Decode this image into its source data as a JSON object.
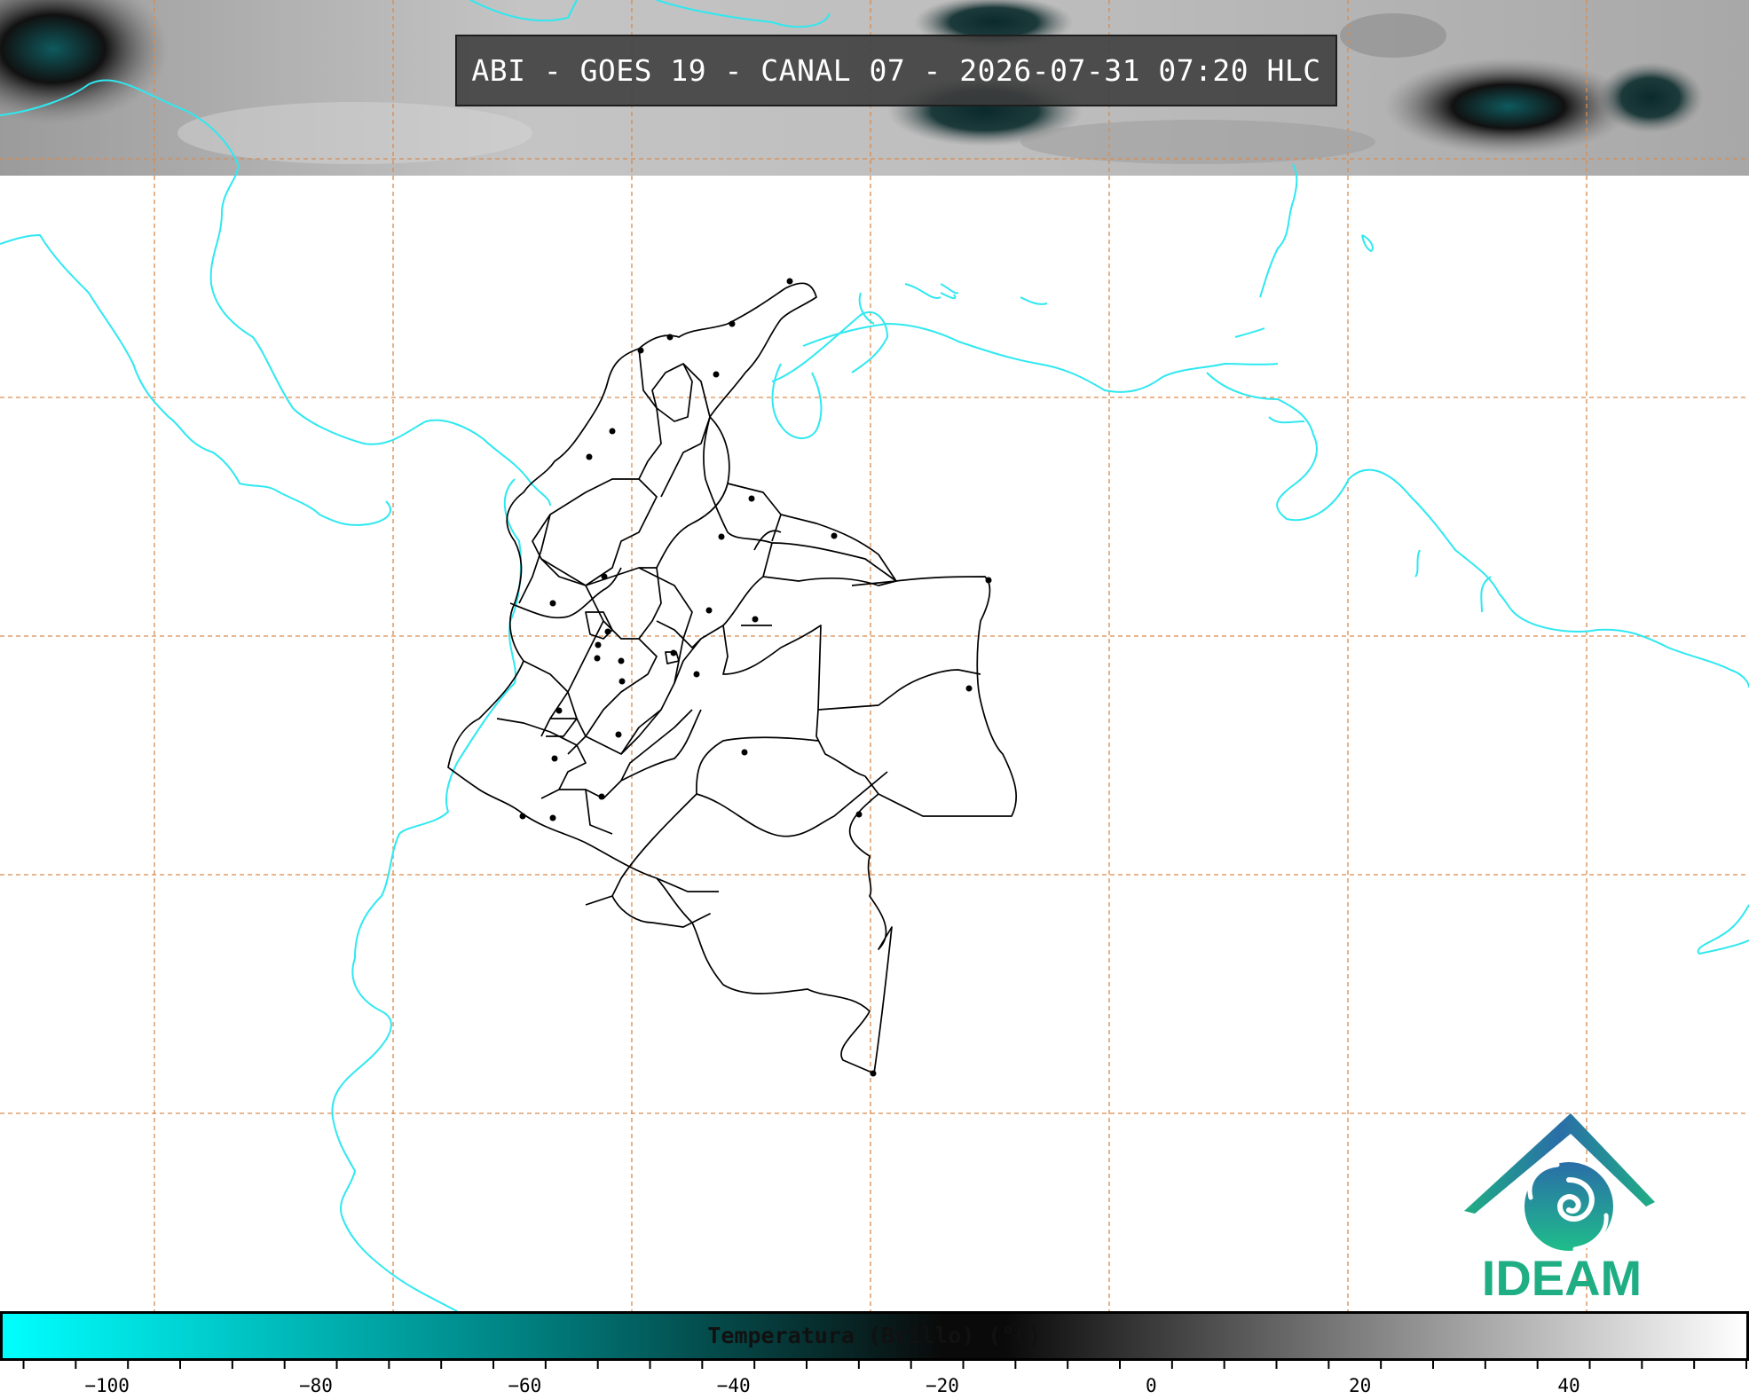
{
  "header": {
    "title": "ABI - GOES 19 - CANAL 07 - 2026-07-31 07:20 HLC"
  },
  "logo": {
    "name": "IDEAM"
  },
  "colorbar": {
    "title": "Temperatura (Brillo) (°C)",
    "tick_labels": [
      "-100",
      "-80",
      "-60",
      "-40",
      "-20",
      "0",
      "20",
      "40"
    ],
    "range_c": [
      -110,
      57
    ],
    "colors": {
      "cold": "#00ffff",
      "teal": "#008080",
      "dark": "#0a0a0a",
      "warm": "#ffffff"
    }
  },
  "map": {
    "coastline_color": "#2fe8f0",
    "grid_color": "#d98c4f",
    "border_color": "#000000",
    "cloud_strip": "satellite imagery present along top edge"
  }
}
